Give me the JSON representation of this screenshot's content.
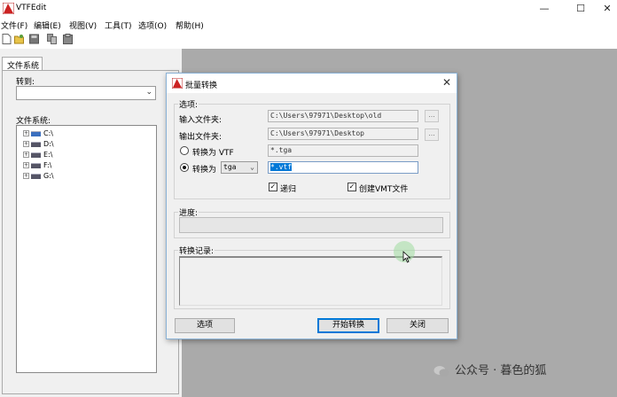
{
  "window": {
    "title": "VTFEdit",
    "controls": {
      "minimize": "—",
      "maximize": "☐",
      "close": "✕"
    }
  },
  "menubar": {
    "items": [
      "文件(F)",
      "编辑(E)",
      "视图(V)",
      "工具(T)",
      "选项(O)",
      "帮助(H)"
    ]
  },
  "toolbar": {
    "icons": [
      "new-file-icon",
      "open-folder-icon",
      "save-icon",
      "copy-icon",
      "paste-icon"
    ]
  },
  "left_panel": {
    "tab_label": "文件系统",
    "goto_label": "转到:",
    "goto_value": "",
    "fs_label": "文件系统:",
    "drives": [
      "C:\\",
      "D:\\",
      "E:\\",
      "F:\\",
      "G:\\"
    ]
  },
  "dialog": {
    "title": "批量转换",
    "close_glyph": "✕",
    "options_group": "选项:",
    "input_folder_label": "输入文件夹:",
    "input_folder_value": "C:\\Users\\97971\\Desktop\\old",
    "output_folder_label": "输出文件夹:",
    "output_folder_value": "C:\\Users\\97971\\Desktop",
    "browse_label": "...",
    "convert_to_vtf_label": "转换为 VTF",
    "convert_to_vtf_filter": "*.tga",
    "convert_to_label": "转换为",
    "convert_to_format": "tga",
    "convert_to_filter": "*.vtf",
    "convert_to_selected": true,
    "recursive_label": "递归",
    "recursive_checked": true,
    "create_vmt_label": "创建VMT文件",
    "create_vmt_checked": true,
    "progress_label": "进度:",
    "progress": 0,
    "log_label": "转换记录:",
    "options_button": "选项",
    "start_button": "开始转换",
    "close_button": "关闭"
  },
  "watermark": {
    "text": "公众号 · 暮色的狐"
  },
  "colors": {
    "accent": "#0078d7",
    "workspace": "#aaaaaa",
    "dialog_border": "#8ab2d6"
  }
}
